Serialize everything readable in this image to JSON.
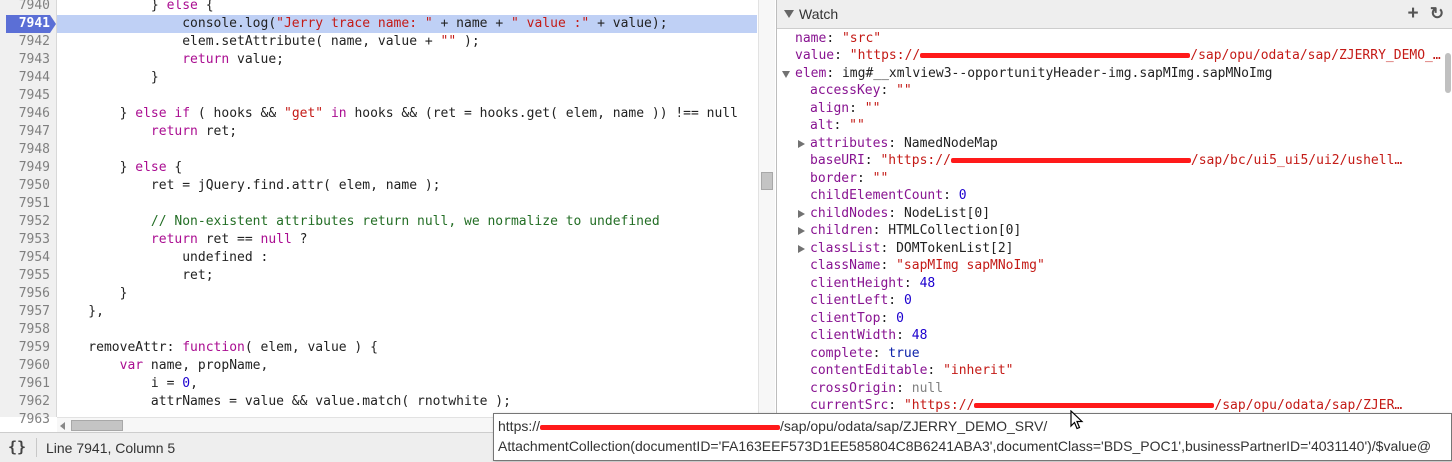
{
  "editor": {
    "current_line": 7941,
    "lines": [
      {
        "n": "7940",
        "tokens": [
          {
            "t": "            } "
          },
          {
            "t": "else",
            "c": "kw"
          },
          {
            "t": " {"
          }
        ]
      },
      {
        "n": "7941",
        "tokens": [
          {
            "t": "                console.log("
          },
          {
            "t": "\"Jerry trace name: \"",
            "c": "str"
          },
          {
            "t": " + name + "
          },
          {
            "t": "\" value :\"",
            "c": "str"
          },
          {
            "t": " + value);"
          }
        ]
      },
      {
        "n": "7942",
        "tokens": [
          {
            "t": "                elem.setAttribute( name, value + "
          },
          {
            "t": "\"\"",
            "c": "str"
          },
          {
            "t": " );"
          }
        ]
      },
      {
        "n": "7943",
        "tokens": [
          {
            "t": "                "
          },
          {
            "t": "return",
            "c": "kw"
          },
          {
            "t": " value;"
          }
        ]
      },
      {
        "n": "7944",
        "tokens": [
          {
            "t": "            }"
          }
        ]
      },
      {
        "n": "7945",
        "tokens": [
          {
            "t": ""
          }
        ]
      },
      {
        "n": "7946",
        "tokens": [
          {
            "t": "        } "
          },
          {
            "t": "else if",
            "c": "kw"
          },
          {
            "t": " ( hooks && "
          },
          {
            "t": "\"get\"",
            "c": "str"
          },
          {
            "t": " "
          },
          {
            "t": "in",
            "c": "kw"
          },
          {
            "t": " hooks && (ret = hooks.get( elem, name )) !== null"
          }
        ]
      },
      {
        "n": "7947",
        "tokens": [
          {
            "t": "            "
          },
          {
            "t": "return",
            "c": "kw"
          },
          {
            "t": " ret;"
          }
        ]
      },
      {
        "n": "7948",
        "tokens": [
          {
            "t": ""
          }
        ]
      },
      {
        "n": "7949",
        "tokens": [
          {
            "t": "        } "
          },
          {
            "t": "else",
            "c": "kw"
          },
          {
            "t": " {"
          }
        ]
      },
      {
        "n": "7950",
        "tokens": [
          {
            "t": "            ret = jQuery.find.attr( elem, name );"
          }
        ]
      },
      {
        "n": "7951",
        "tokens": [
          {
            "t": ""
          }
        ]
      },
      {
        "n": "7952",
        "tokens": [
          {
            "t": "            "
          },
          {
            "t": "// Non-existent attributes return null, we normalize to undefined",
            "c": "cm"
          }
        ]
      },
      {
        "n": "7953",
        "tokens": [
          {
            "t": "            "
          },
          {
            "t": "return",
            "c": "kw"
          },
          {
            "t": " ret == "
          },
          {
            "t": "null",
            "c": "kw"
          },
          {
            "t": " ?"
          }
        ]
      },
      {
        "n": "7954",
        "tokens": [
          {
            "t": "                undefined :"
          }
        ]
      },
      {
        "n": "7955",
        "tokens": [
          {
            "t": "                ret;"
          }
        ]
      },
      {
        "n": "7956",
        "tokens": [
          {
            "t": "        }"
          }
        ]
      },
      {
        "n": "7957",
        "tokens": [
          {
            "t": "    },"
          }
        ]
      },
      {
        "n": "7958",
        "tokens": [
          {
            "t": ""
          }
        ]
      },
      {
        "n": "7959",
        "tokens": [
          {
            "t": "    removeAttr: "
          },
          {
            "t": "function",
            "c": "kw"
          },
          {
            "t": "( elem, value ) {"
          }
        ]
      },
      {
        "n": "7960",
        "tokens": [
          {
            "t": "        "
          },
          {
            "t": "var",
            "c": "kw"
          },
          {
            "t": " name, propName,"
          }
        ]
      },
      {
        "n": "7961",
        "tokens": [
          {
            "t": "            i = "
          },
          {
            "t": "0",
            "c": "num"
          },
          {
            "t": ","
          }
        ]
      },
      {
        "n": "7962",
        "tokens": [
          {
            "t": "            attrNames = value && value.match( rnotwhite );"
          }
        ]
      },
      {
        "n": "7963",
        "tokens": [
          {
            "t": ""
          }
        ]
      }
    ]
  },
  "watch": {
    "title": "Watch",
    "add_icon": "plus-icon",
    "refresh_icon": "refresh-icon",
    "rows": [
      {
        "indent": 0,
        "key": "name",
        "sep": ": ",
        "val": "\"src\"",
        "vc": "str"
      },
      {
        "indent": 0,
        "key": "value",
        "sep": ": ",
        "val_pre": "\"https://",
        "redact": true,
        "val": "/sap/opu/odata/sap/ZJERRY_DEMO_…",
        "vc": "str"
      },
      {
        "indent": 0,
        "toggle": "d",
        "key": "elem",
        "sep": ": ",
        "val": "img#__xmlview3--opportunityHeader-img.sapMImg.sapMNoImg",
        "vc": "obj"
      },
      {
        "indent": 1,
        "key": "accessKey",
        "sep": ": ",
        "val": "\"\"",
        "vc": "str"
      },
      {
        "indent": 1,
        "key": "align",
        "sep": ": ",
        "val": "\"\"",
        "vc": "str"
      },
      {
        "indent": 1,
        "key": "alt",
        "sep": ": ",
        "val": "\"\"",
        "vc": "str"
      },
      {
        "indent": 1,
        "toggle": "r",
        "key": "attributes",
        "sep": ": ",
        "val": "NamedNodeMap",
        "vc": "obj"
      },
      {
        "indent": 1,
        "key": "baseURI",
        "sep": ": ",
        "val_pre": "\"https://",
        "redact": true,
        "val": "/sap/bc/ui5_ui5/ui2/ushell…",
        "vc": "str"
      },
      {
        "indent": 1,
        "key": "border",
        "sep": ": ",
        "val": "\"\"",
        "vc": "str"
      },
      {
        "indent": 1,
        "key": "childElementCount",
        "sep": ": ",
        "val": "0",
        "vc": "num"
      },
      {
        "indent": 1,
        "toggle": "r",
        "key": "childNodes",
        "sep": ": ",
        "val": "NodeList[0]",
        "vc": "obj"
      },
      {
        "indent": 1,
        "toggle": "r",
        "key": "children",
        "sep": ": ",
        "val": "HTMLCollection[0]",
        "vc": "obj"
      },
      {
        "indent": 1,
        "toggle": "r",
        "key": "classList",
        "sep": ": ",
        "val": "DOMTokenList[2]",
        "vc": "obj"
      },
      {
        "indent": 1,
        "key": "className",
        "sep": ": ",
        "val": "\"sapMImg sapMNoImg\"",
        "vc": "str"
      },
      {
        "indent": 1,
        "key": "clientHeight",
        "sep": ": ",
        "val": "48",
        "vc": "num"
      },
      {
        "indent": 1,
        "key": "clientLeft",
        "sep": ": ",
        "val": "0",
        "vc": "num"
      },
      {
        "indent": 1,
        "key": "clientTop",
        "sep": ": ",
        "val": "0",
        "vc": "num"
      },
      {
        "indent": 1,
        "key": "clientWidth",
        "sep": ": ",
        "val": "48",
        "vc": "num"
      },
      {
        "indent": 1,
        "key": "complete",
        "sep": ": ",
        "val": "true",
        "vc": "kw"
      },
      {
        "indent": 1,
        "key": "contentEditable",
        "sep": ": ",
        "val": "\"inherit\"",
        "vc": "str"
      },
      {
        "indent": 1,
        "key": "crossOrigin",
        "sep": ": ",
        "val": "null",
        "vc": "null"
      },
      {
        "indent": 1,
        "key": "currentSrc",
        "sep": ": ",
        "val_pre": "\"https://",
        "redact": true,
        "val": "/sap/opu/odata/sap/ZJER…",
        "vc": "str"
      }
    ]
  },
  "status": {
    "pretty_print_label": "{}",
    "cursor_position": "Line 7941, Column 5"
  },
  "tooltip": {
    "line1_pre": "https://",
    "line1_post": "/sap/opu/odata/sap/ZJERRY_DEMO_SRV/",
    "line2": "AttachmentCollection(documentID='FA163EEF573D1EE585804C8B6241ABA3',documentClass='BDS_POC1',businessPartnerID='4031140')/$value@"
  },
  "colors": {
    "current_line_number": "#5b6fd6",
    "current_line_bg": "#bfd0f5",
    "redaction": "#ff1a1a"
  }
}
